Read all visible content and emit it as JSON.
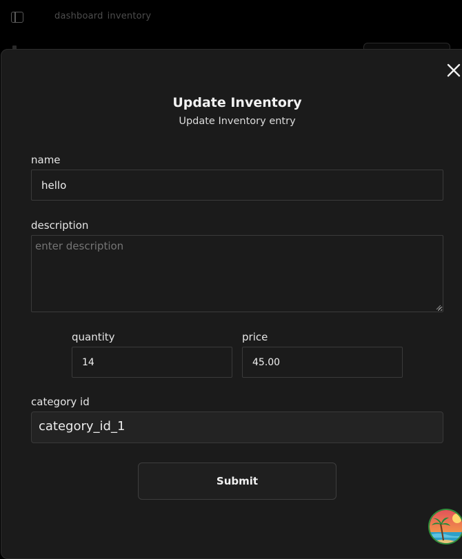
{
  "topbar": {
    "breadcrumb": [
      "dashboard",
      "inventory"
    ]
  },
  "dialog": {
    "title": "Update Inventory",
    "subtitle": "Update Inventory entry",
    "close_icon": "close-icon",
    "fields": {
      "name": {
        "label": "name",
        "value": "hello"
      },
      "description": {
        "label": "description",
        "placeholder": "enter description",
        "value": ""
      },
      "quantity": {
        "label": "quantity",
        "value": "14"
      },
      "price": {
        "label": "price",
        "value": "45.00"
      },
      "category_id": {
        "label": "category id",
        "value": "category_id_1"
      }
    },
    "submit_label": "Submit"
  },
  "colors": {
    "background": "#000000",
    "dialog_background": "#1b1b1b",
    "field_border": "#3b3b3b",
    "avatar_ring": "#2f8f3a"
  }
}
